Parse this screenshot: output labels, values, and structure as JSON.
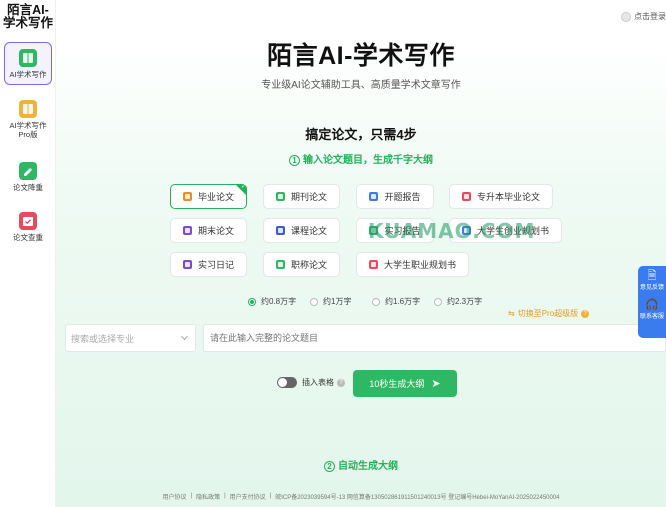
{
  "sidebar": {
    "brand": "陌言AI-学术写作",
    "items": [
      {
        "label": "AI学术写作",
        "icon": "book-icon",
        "color": "#2fb864",
        "active": true
      },
      {
        "label": "AI学术写作Pro版",
        "icon": "book-pro-icon",
        "color": "#f2b13b",
        "active": false
      },
      {
        "label": "论文降重",
        "icon": "edit-icon",
        "color": "#2fb864",
        "active": false
      },
      {
        "label": "论文查重",
        "icon": "calendar-check-icon",
        "color": "#e84a5f",
        "active": false
      }
    ]
  },
  "header": {
    "login": "点击登录"
  },
  "hero": {
    "title": "陌言AI-学术写作",
    "subtitle": "专业级AI论文辅助工具、高质量学术文章写作"
  },
  "section": {
    "heading": "搞定论文，只需4步",
    "step1_num": "1",
    "step1": "输入论文题目，生成千字大纲",
    "step2_num": "2",
    "step2": "自动生成大纲"
  },
  "paper_types": [
    {
      "label": "毕业论文",
      "color": "#f08c22",
      "selected": true
    },
    {
      "label": "期刊论文",
      "color": "#2fb864",
      "selected": false
    },
    {
      "label": "开题报告",
      "color": "#3b7bf0",
      "selected": false
    },
    {
      "label": "专升本毕业论文",
      "color": "#e84a5f",
      "selected": false
    },
    {
      "label": "期末论文",
      "color": "#7b4ad8",
      "selected": false
    },
    {
      "label": "课程论文",
      "color": "#3b5bd8",
      "selected": false
    },
    {
      "label": "实习报告",
      "color": "#2fb864",
      "selected": false
    },
    {
      "label": "大学生创业规划书",
      "color": "#3b7bf0",
      "selected": false
    },
    {
      "label": "实习日记",
      "color": "#7b4ad8",
      "selected": false
    },
    {
      "label": "职称论文",
      "color": "#2fb864",
      "selected": false
    },
    {
      "label": "大学生职业规划书",
      "color": "#e84a5f",
      "selected": false
    }
  ],
  "word_counts": [
    {
      "label": "约0.8万字",
      "selected": true
    },
    {
      "label": "约1万字",
      "selected": false
    },
    {
      "label": "约1.6万字",
      "selected": false
    },
    {
      "label": "约2.3万字",
      "selected": false
    }
  ],
  "pro_link": "切换至Pro超级版",
  "form": {
    "major_placeholder": "搜索或选择专业",
    "topic_placeholder": "请在此输入完整的论文题目",
    "toggle_label": "插入表格",
    "generate_label": "10秒生成大纲"
  },
  "footer": {
    "items": [
      "用户协议",
      "|",
      "隐私政策",
      "|",
      "用户支付协议",
      "|",
      "皖ICP备2023039594号-13 网信算备130502861911501240013号 登记编号Hebei-MoYanAI-2025022450004"
    ]
  },
  "float_panel": [
    {
      "label": "意见反馈",
      "icon": "document-icon"
    },
    {
      "label": "联系客服",
      "icon": "headset-icon"
    }
  ],
  "watermark": "KUAMAO.COM"
}
